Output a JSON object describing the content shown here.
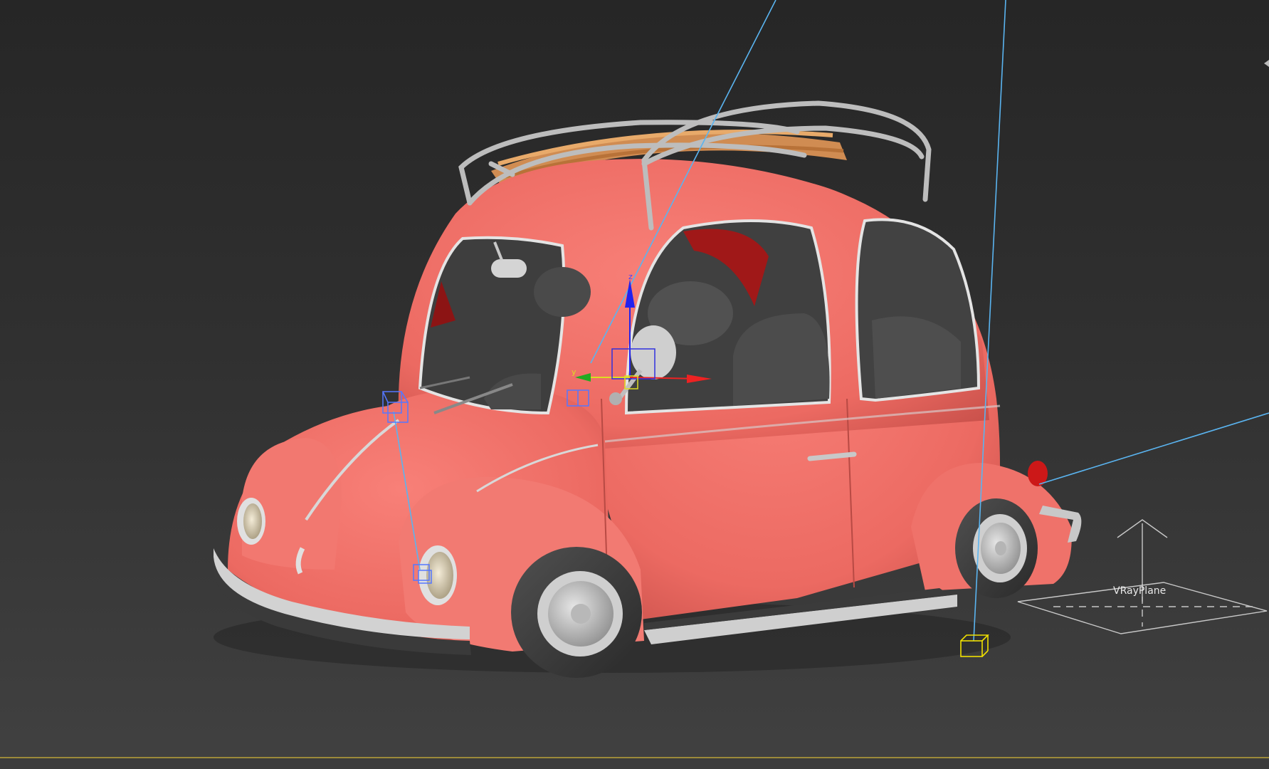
{
  "viewport": {
    "object_label": "VRayPlane",
    "background_top": "#262626",
    "background_bottom": "#414141",
    "colors": {
      "body": "#f07068",
      "body_shadow": "#c9524c",
      "chrome": "#c8c8c8",
      "interior": "#444444",
      "wood": "#d89858",
      "light_line": "#5ab4f0",
      "gizmo_x": "#ee2222",
      "gizmo_y": "#22cc22",
      "gizmo_z": "#2222ee",
      "helper_selected": "#f0e000",
      "helper_blue": "#5577ff"
    }
  }
}
